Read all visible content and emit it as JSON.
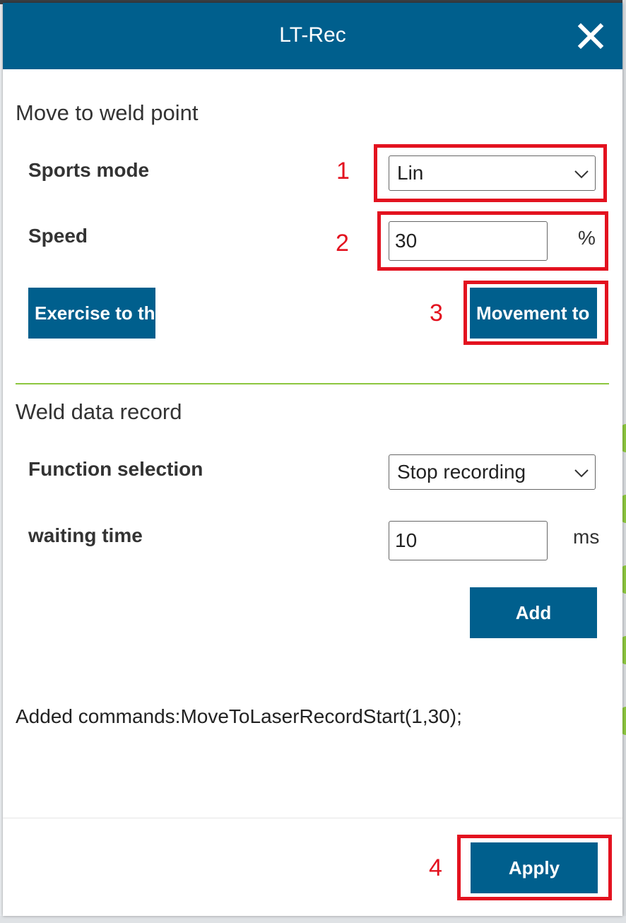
{
  "dialog": {
    "title": "LT-Rec",
    "close_icon": "close-icon"
  },
  "move_section": {
    "title": "Move to weld point",
    "sports_mode": {
      "label": "Sports mode",
      "value": "Lin"
    },
    "speed": {
      "label": "Speed",
      "value": "30",
      "unit": "%"
    },
    "exercise_button": "Exercise to th",
    "movement_button": "Movement to"
  },
  "record_section": {
    "title": "Weld data record",
    "function_selection": {
      "label": "Function selection",
      "value": "Stop recording"
    },
    "waiting_time": {
      "label": "waiting time",
      "value": "10",
      "unit": "ms"
    },
    "add_button": "Add"
  },
  "added_commands": "Added commands:MoveToLaserRecordStart(1,30);",
  "footer": {
    "apply_button": "Apply"
  },
  "annotations": {
    "color": "#e3121f",
    "numbers": [
      "1",
      "2",
      "3",
      "4"
    ]
  },
  "colors": {
    "primary": "#005f8d",
    "divider": "#8cc63f"
  }
}
